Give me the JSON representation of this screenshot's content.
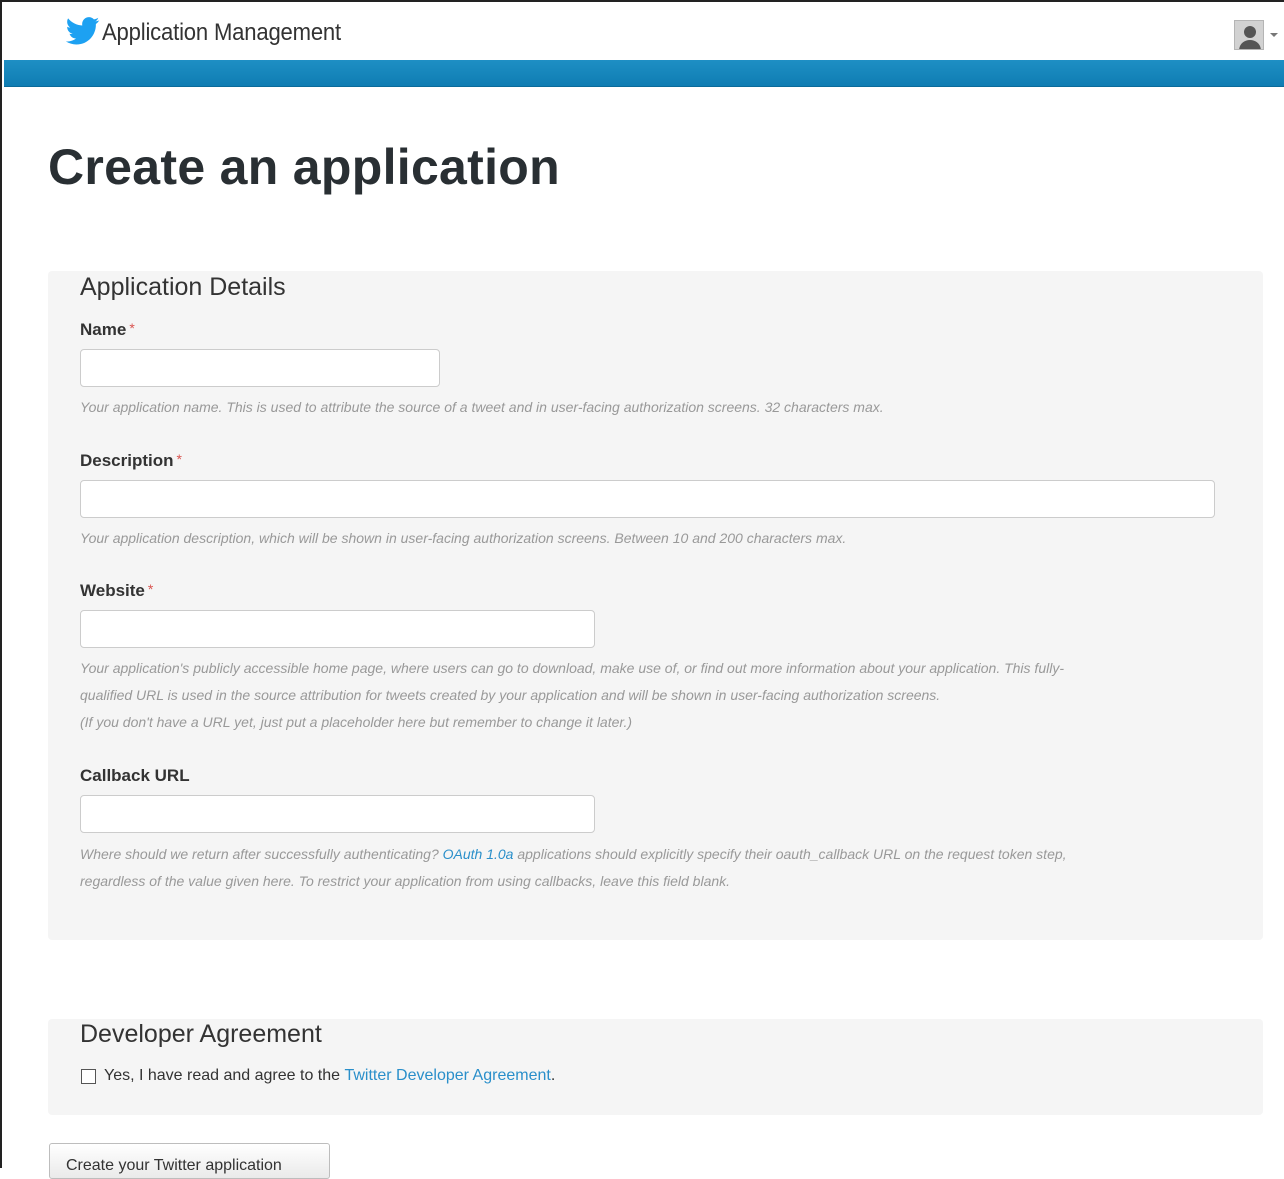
{
  "header": {
    "app_title": "Application Management",
    "logo_icon": "twitter-bird-icon",
    "user_icon": "user-avatar-icon",
    "accent_color": "#1b8bc0"
  },
  "page": {
    "title": "Create an application"
  },
  "details": {
    "title": "Application Details",
    "required_mark": "*",
    "fields": {
      "name": {
        "label": "Name",
        "value": "",
        "help": "Your application name. This is used to attribute the source of a tweet and in user-facing authorization screens. 32 characters max."
      },
      "description": {
        "label": "Description",
        "value": "",
        "help": "Your application description, which will be shown in user-facing authorization screens. Between 10 and 200 characters max."
      },
      "website": {
        "label": "Website",
        "value": "",
        "help_line1": "Your application's publicly accessible home page, where users can go to download, make use of, or find out more information about your application. This fully-",
        "help_line2": "qualified URL is used in the source attribution for tweets created by your application and will be shown in user-facing authorization screens.",
        "help_line3": "(If you don't have a URL yet, just put a placeholder here but remember to change it later.)"
      },
      "callback": {
        "label": "Callback URL",
        "value": "",
        "help_pre": "Where should we return after successfully authenticating? ",
        "help_link": "OAuth 1.0a",
        "help_post": " applications should explicitly specify their oauth_callback URL on the request token step,",
        "help_line2": "regardless of the value given here. To restrict your application from using callbacks, leave this field blank."
      }
    }
  },
  "agreement": {
    "title": "Developer Agreement",
    "checked": false,
    "text_pre": "Yes, I have read and agree to the ",
    "link": "Twitter Developer Agreement",
    "text_post": "."
  },
  "submit": {
    "label": "Create your Twitter application"
  }
}
